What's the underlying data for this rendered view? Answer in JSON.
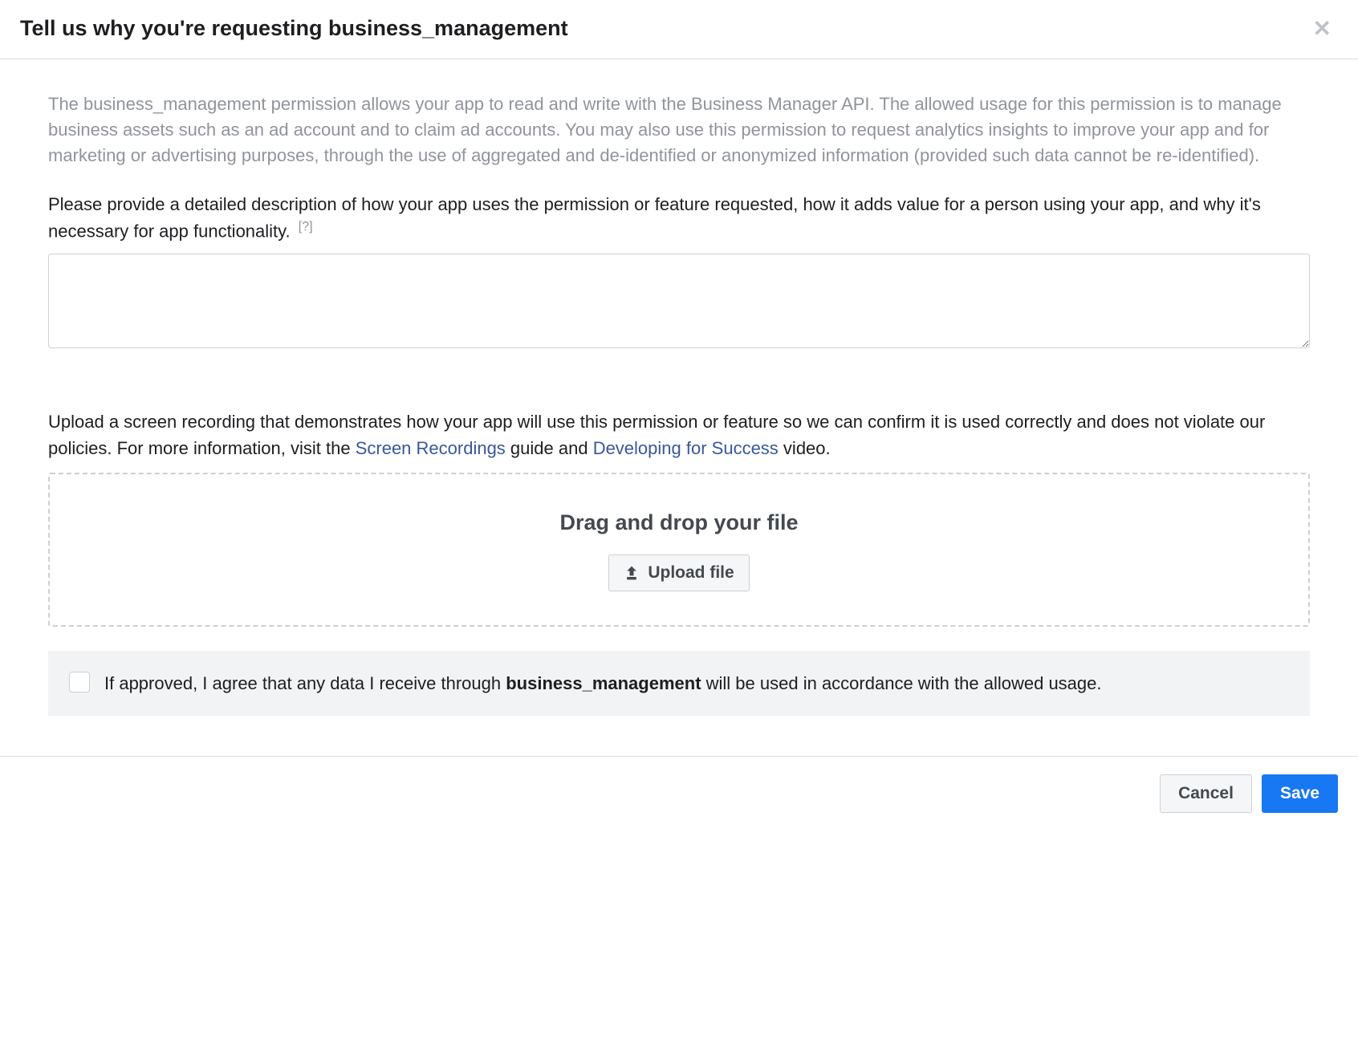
{
  "header": {
    "title": "Tell us why you're requesting business_management"
  },
  "body": {
    "permission_description": "The business_management permission allows your app to read and write with the Business Manager API. The allowed usage for this permission is to manage business assets such as an ad account and to claim ad accounts. You may also use this permission to request analytics insights to improve your app and for marketing or advertising purposes, through the use of aggregated and de-identified or anonymized information (provided such data cannot be re-identified).",
    "detail_request": "Please provide a detailed description of how your app uses the permission or feature requested, how it adds value for a person using your app, and why it's necessary for app functionality.",
    "help_marker": "[?]",
    "textarea_value": "",
    "upload_instruction_pre": "Upload a screen recording that demonstrates how your app will use this permission or feature so we can confirm it is used correctly and does not violate our policies. For more information, visit the ",
    "link_screen_recordings": "Screen Recordings",
    "upload_instruction_mid1": " guide and ",
    "link_developing": "Developing for Success",
    "upload_instruction_end": " video.",
    "dropzone_title": "Drag and drop your file",
    "upload_button_label": "Upload file",
    "agreement_pre": "If approved, I agree that any data I receive through ",
    "agreement_perm": "business_management",
    "agreement_post": " will be used in accordance with the allowed usage."
  },
  "footer": {
    "cancel_label": "Cancel",
    "save_label": "Save"
  }
}
